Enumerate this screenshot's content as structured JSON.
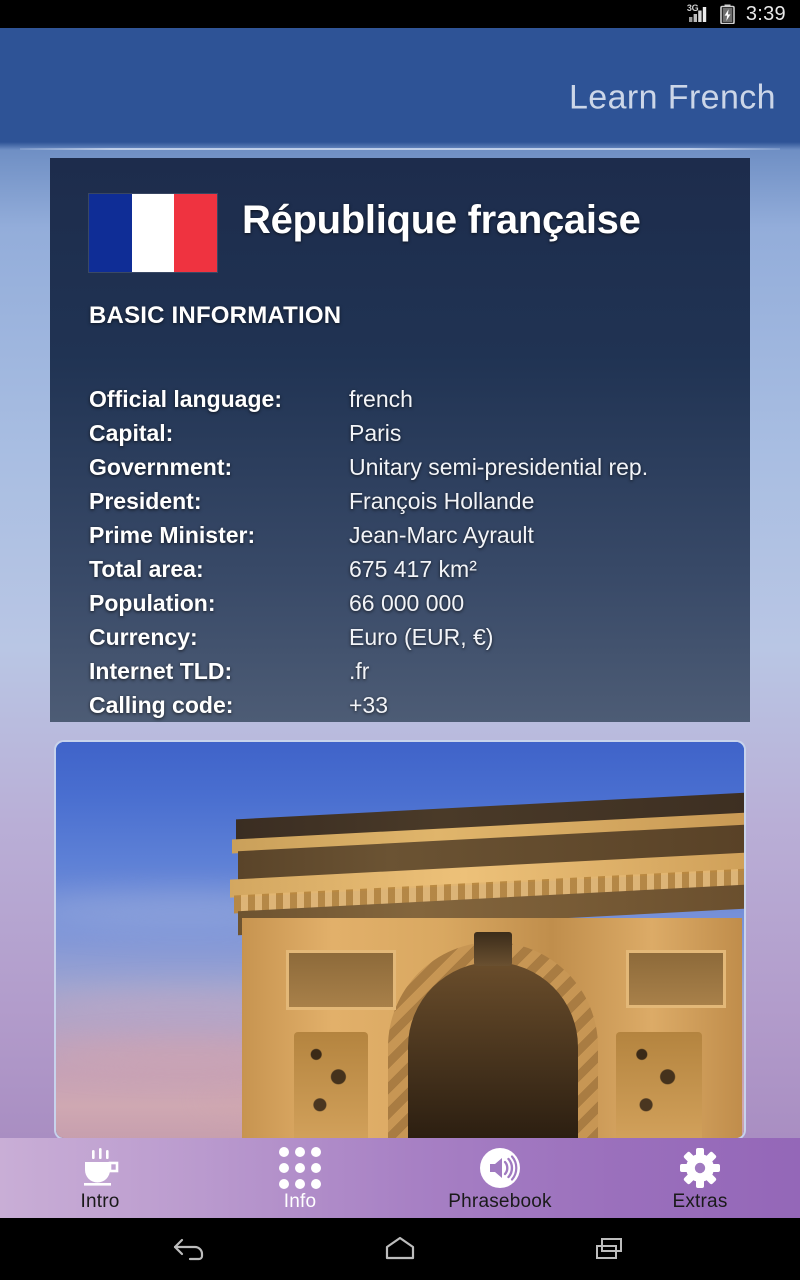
{
  "statusbar": {
    "network_label": "3G",
    "time": "3:39",
    "icons": [
      "signal-3g-icon",
      "battery-charging-icon"
    ]
  },
  "header": {
    "app_title": "Learn French"
  },
  "info_card": {
    "flag": {
      "name": "french-flag",
      "colors": [
        "#0f2d96",
        "#ffffff",
        "#ef3340"
      ]
    },
    "country_title": "République française",
    "section_heading": "BASIC INFORMATION",
    "facts": [
      {
        "label": "Official language:",
        "value": "french"
      },
      {
        "label": "Capital:",
        "value": "Paris"
      },
      {
        "label": "Government:",
        "value": "Unitary semi-presidential rep."
      },
      {
        "label": "President:",
        "value": "François Hollande"
      },
      {
        "label": "Prime Minister:",
        "value": "Jean-Marc Ayrault"
      },
      {
        "label": "Total area:",
        "value": "675 417 km²"
      },
      {
        "label": "Population:",
        "value": "66 000 000"
      },
      {
        "label": "Currency:",
        "value": "Euro  (EUR, €)"
      },
      {
        "label": "Internet TLD:",
        "value": ".fr"
      },
      {
        "label": "Calling code:",
        "value": "+33"
      }
    ]
  },
  "photo_card": {
    "name": "arc-de-triomphe-photo",
    "alt": "Arc de Triomphe at dusk"
  },
  "tabbar": {
    "active": "Info",
    "tabs": [
      {
        "label": "Intro",
        "icon": "coffee-cup-icon"
      },
      {
        "label": "Info",
        "icon": "grid-dots-icon"
      },
      {
        "label": "Phrasebook",
        "icon": "speaker-volume-icon"
      },
      {
        "label": "Extras",
        "icon": "gear-icon"
      }
    ]
  },
  "navbar": {
    "buttons": [
      {
        "name": "back",
        "icon": "back-arrow-icon"
      },
      {
        "name": "home",
        "icon": "home-icon"
      },
      {
        "name": "recents",
        "icon": "recent-apps-icon"
      }
    ]
  },
  "colors": {
    "header_blue": "#2e5396",
    "card_navy": "#1d2c4c",
    "tabbar_purple_light": "#c9aed6",
    "tabbar_purple_dark": "#9467b8"
  }
}
